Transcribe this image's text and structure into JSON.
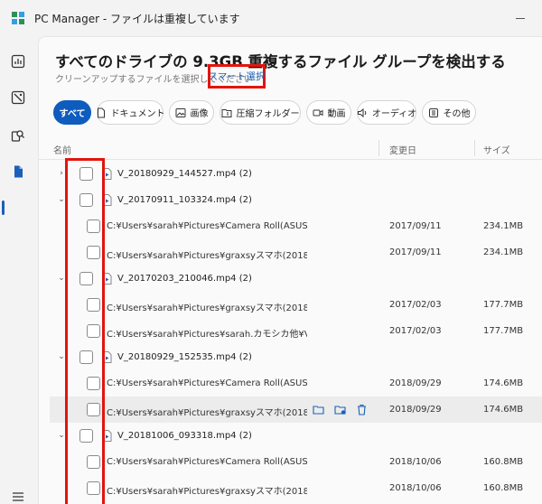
{
  "app": {
    "title": "PC Manager - ファイルは重複しています"
  },
  "colors": {
    "accent": "#0f5cbf",
    "highlight": "#e3140e",
    "link": "#1a5fb4"
  },
  "sidebar": {
    "items": [
      {
        "icon": "dashboard-icon"
      },
      {
        "icon": "storage-icon"
      },
      {
        "icon": "app-search-icon"
      },
      {
        "icon": "files-icon",
        "active": true
      },
      {
        "icon": "menu-icon"
      }
    ]
  },
  "header": {
    "title": "すべてのドライブの 9.3GB 重複するファイル グループを検出する",
    "subtitle": "クリーンアップするファイルを選択してください",
    "smart_select": "スマート選択"
  },
  "filters": [
    {
      "label": "すべて",
      "icon": "",
      "active": true
    },
    {
      "label": "ドキュメント",
      "icon": "document-icon"
    },
    {
      "label": "画像",
      "icon": "image-icon"
    },
    {
      "label": "圧縮フォルダー",
      "icon": "zip-folder-icon"
    },
    {
      "label": "動画",
      "icon": "video-icon"
    },
    {
      "label": "オーディオ",
      "icon": "audio-icon"
    },
    {
      "label": "その他",
      "icon": "other-icon"
    }
  ],
  "table": {
    "columns": {
      "name": "名前",
      "date": "変更日",
      "size": "サイズ"
    },
    "rows": [
      {
        "type": "group",
        "expanded": false,
        "name": "V_20180929_144527.mp4 (2)"
      },
      {
        "type": "group",
        "expanded": true,
        "name": "V_20170911_103324.mp4 (2)"
      },
      {
        "type": "file",
        "path": "C:¥Users¥sarah¥Pictures¥Camera Roll(ASUS)¥V...",
        "date": "2017/09/11",
        "size": "234.1MB"
      },
      {
        "type": "file",
        "path": "C:¥Users¥sarah¥Pictures¥graxsyスマホ(2018.5.1...",
        "date": "2017/09/11",
        "size": "234.1MB"
      },
      {
        "type": "group",
        "expanded": true,
        "name": "V_20170203_210046.mp4 (2)"
      },
      {
        "type": "file",
        "path": "C:¥Users¥sarah¥Pictures¥graxsyスマホ(2018.5.1...",
        "date": "2017/02/03",
        "size": "177.7MB"
      },
      {
        "type": "file",
        "path": "C:¥Users¥sarah¥Pictures¥sarah.カモシカ他¥V_20...",
        "date": "2017/02/03",
        "size": "177.7MB"
      },
      {
        "type": "group",
        "expanded": true,
        "name": "V_20180929_152535.mp4 (2)"
      },
      {
        "type": "file",
        "path": "C:¥Users¥sarah¥Pictures¥Camera Roll(ASUS)¥V...",
        "date": "2018/09/29",
        "size": "174.6MB"
      },
      {
        "type": "file",
        "path": "C:¥Users¥sarah¥Pictures¥graxsyスマホ(2018.5.1...",
        "date": "2018/09/29",
        "size": "174.6MB",
        "hover": true
      },
      {
        "type": "group",
        "expanded": true,
        "name": "V_20181006_093318.mp4 (2)"
      },
      {
        "type": "file",
        "path": "C:¥Users¥sarah¥Pictures¥Camera Roll(ASUS)¥V...",
        "date": "2018/10/06",
        "size": "160.8MB"
      },
      {
        "type": "file",
        "path": "C:¥Users¥sarah¥Pictures¥graxsyスマホ(2018.5.1...",
        "date": "2018/10/06",
        "size": "160.8MB"
      }
    ]
  }
}
